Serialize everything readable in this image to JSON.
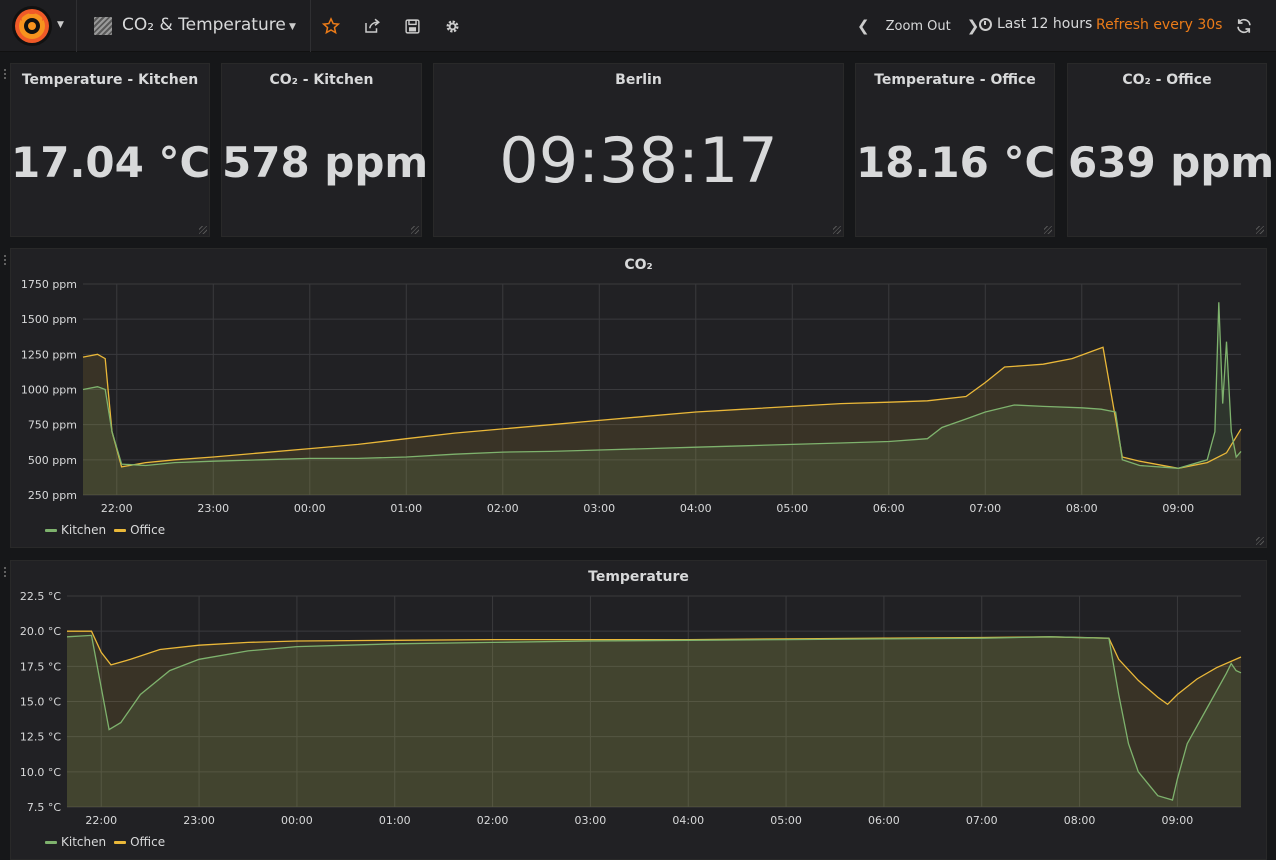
{
  "header": {
    "dashboard_title": "CO₂ & Temperature",
    "zoom_out_label": "Zoom Out",
    "time_range": "Last 12 hours",
    "refresh": "Refresh every 30s"
  },
  "colors": {
    "kitchen": "#7eb26d",
    "office": "#eab839",
    "accent": "#eb7b18"
  },
  "stats": [
    {
      "title": "Temperature - Kitchen",
      "value": "17.04 °C"
    },
    {
      "title": "CO₂ - Kitchen",
      "value": "578 ppm"
    },
    {
      "title": "Berlin",
      "value": "09:38:17"
    },
    {
      "title": "Temperature - Office",
      "value": "18.16 °C"
    },
    {
      "title": "CO₂ - Office",
      "value": "639 ppm"
    }
  ],
  "chart_data": [
    {
      "type": "area",
      "title": "CO₂",
      "unit": "ppm",
      "ylim": [
        250,
        1750
      ],
      "yticks": [
        250,
        500,
        750,
        1000,
        1250,
        1500,
        1750
      ],
      "ytick_labels": [
        "250 ppm",
        "500 ppm",
        "750 ppm",
        "1000 ppm",
        "1250 ppm",
        "1500 ppm",
        "1750 ppm"
      ],
      "xlim": [
        21.65,
        33.65
      ],
      "xticks": [
        22,
        23,
        24,
        25,
        26,
        27,
        28,
        29,
        30,
        31,
        32,
        33
      ],
      "xtick_labels": [
        "22:00",
        "23:00",
        "00:00",
        "01:00",
        "02:00",
        "03:00",
        "04:00",
        "05:00",
        "06:00",
        "07:00",
        "08:00",
        "09:00"
      ],
      "grid": true,
      "legend": "bottom-left",
      "series": [
        {
          "name": "Kitchen",
          "color": "#7eb26d",
          "x": [
            21.65,
            21.8,
            21.88,
            21.95,
            22.05,
            22.3,
            22.6,
            23.0,
            23.5,
            24.0,
            24.5,
            25.0,
            25.5,
            26.0,
            26.5,
            27.0,
            27.5,
            28.0,
            28.5,
            29.0,
            29.5,
            30.0,
            30.4,
            30.55,
            30.8,
            31.0,
            31.3,
            31.6,
            32.0,
            32.2,
            32.35,
            32.42,
            32.6,
            33.0,
            33.3,
            33.38,
            33.42,
            33.46,
            33.5,
            33.55,
            33.6,
            33.65
          ],
          "y": [
            1000,
            1020,
            1000,
            700,
            470,
            460,
            480,
            490,
            500,
            510,
            510,
            520,
            540,
            555,
            560,
            570,
            580,
            590,
            600,
            610,
            620,
            630,
            650,
            730,
            790,
            840,
            890,
            880,
            870,
            860,
            840,
            500,
            460,
            440,
            500,
            700,
            1620,
            900,
            1340,
            700,
            520,
            560
          ]
        },
        {
          "name": "Office",
          "color": "#eab839",
          "x": [
            21.65,
            21.8,
            21.88,
            21.95,
            22.05,
            22.3,
            22.6,
            23.0,
            23.5,
            24.0,
            24.5,
            25.0,
            25.5,
            26.0,
            26.5,
            27.0,
            27.5,
            28.0,
            28.5,
            29.0,
            29.5,
            30.0,
            30.4,
            30.8,
            31.0,
            31.2,
            31.4,
            31.6,
            31.9,
            32.1,
            32.22,
            32.42,
            32.6,
            33.0,
            33.3,
            33.5,
            33.65
          ],
          "y": [
            1230,
            1250,
            1220,
            700,
            450,
            480,
            500,
            520,
            550,
            580,
            610,
            650,
            690,
            720,
            750,
            780,
            810,
            840,
            860,
            880,
            900,
            910,
            920,
            950,
            1050,
            1160,
            1170,
            1180,
            1220,
            1270,
            1300,
            520,
            490,
            440,
            480,
            550,
            720
          ]
        }
      ]
    },
    {
      "type": "area",
      "title": "Temperature",
      "unit": "°C",
      "ylim": [
        7.5,
        22.5
      ],
      "yticks": [
        7.5,
        10,
        12.5,
        15,
        17.5,
        20,
        22.5
      ],
      "ytick_labels": [
        "7.5 °C",
        "10.0 °C",
        "12.5 °C",
        "15.0 °C",
        "17.5 °C",
        "20.0 °C",
        "22.5 °C"
      ],
      "xlim": [
        21.65,
        33.65
      ],
      "xticks": [
        22,
        23,
        24,
        25,
        26,
        27,
        28,
        29,
        30,
        31,
        32,
        33
      ],
      "xtick_labels": [
        "22:00",
        "23:00",
        "00:00",
        "01:00",
        "02:00",
        "03:00",
        "04:00",
        "05:00",
        "06:00",
        "07:00",
        "08:00",
        "09:00"
      ],
      "grid": true,
      "legend": "bottom-left",
      "series": [
        {
          "name": "Kitchen",
          "color": "#7eb26d",
          "x": [
            21.65,
            21.9,
            22.0,
            22.08,
            22.2,
            22.4,
            22.7,
            23.0,
            23.5,
            24.0,
            25.0,
            26.0,
            27.0,
            28.0,
            29.0,
            30.0,
            31.0,
            31.7,
            32.3,
            32.4,
            32.5,
            32.6,
            32.8,
            32.95,
            33.0,
            33.1,
            33.3,
            33.5,
            33.55,
            33.6,
            33.65
          ],
          "y": [
            19.6,
            19.7,
            16.0,
            13.0,
            13.5,
            15.5,
            17.2,
            18.0,
            18.6,
            18.9,
            19.1,
            19.2,
            19.3,
            19.35,
            19.4,
            19.45,
            19.5,
            19.6,
            19.5,
            15.5,
            12.0,
            10.0,
            8.3,
            8.0,
            9.5,
            12.0,
            14.5,
            17.0,
            17.7,
            17.2,
            17.04
          ]
        },
        {
          "name": "Office",
          "color": "#eab839",
          "x": [
            21.65,
            21.9,
            22.0,
            22.1,
            22.3,
            22.6,
            23.0,
            23.5,
            24.0,
            25.0,
            26.0,
            27.0,
            28.0,
            29.0,
            30.0,
            31.0,
            31.7,
            32.3,
            32.4,
            32.6,
            32.8,
            32.9,
            33.0,
            33.2,
            33.4,
            33.65
          ],
          "y": [
            20.0,
            20.0,
            18.5,
            17.6,
            18.0,
            18.7,
            19.0,
            19.2,
            19.3,
            19.35,
            19.4,
            19.4,
            19.4,
            19.45,
            19.5,
            19.55,
            19.6,
            19.5,
            18.0,
            16.5,
            15.3,
            14.8,
            15.5,
            16.6,
            17.4,
            18.16
          ]
        }
      ]
    }
  ]
}
